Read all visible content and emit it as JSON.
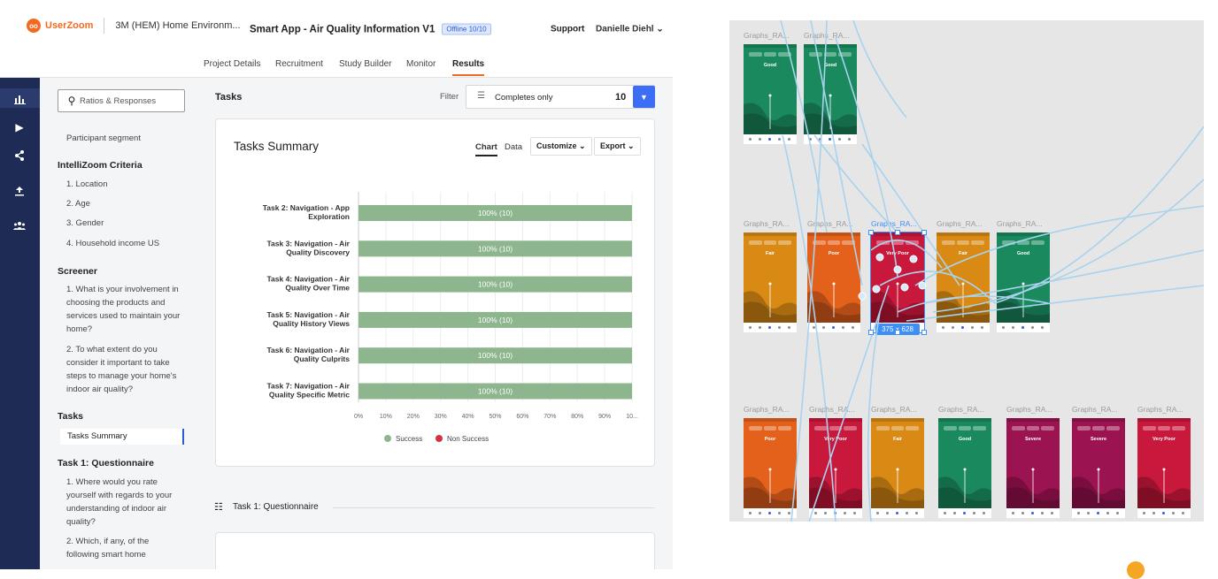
{
  "app": {
    "logo": "UserZoom",
    "org": "3M (HEM) Home Environm...",
    "study_title": "Smart App - Air Quality Information V1",
    "offline_badge": "Offline 10/10",
    "support": "Support",
    "user": "Danielle Diehl ⌄"
  },
  "nav_tabs": [
    "Project Details",
    "Recruitment",
    "Study Builder",
    "Monitor",
    "Results"
  ],
  "active_nav_tab": "Results",
  "rail_icons": [
    "bar-chart-icon",
    "play-icon",
    "share-icon",
    "upload-icon",
    "users-icon"
  ],
  "left_panel": {
    "search_placeholder": "Ratios & Responses",
    "participant_segment": "Participant segment",
    "intellizoom_heading": "IntelliZoom Criteria",
    "intellizoom_items": [
      "1. Location",
      "2. Age",
      "3. Gender",
      "4. Household income US"
    ],
    "screener_heading": "Screener",
    "screener_q1": "1. What is your involvement in choosing the products and services used to maintain your home?",
    "screener_q2": "2. To what extent do you consider it important to take steps to manage your home's indoor air quality?",
    "tasks_heading": "Tasks",
    "tasks_summary": "Tasks Summary",
    "task1_heading": "Task 1: Questionnaire",
    "task1_q1": "1. Where would you rate yourself with regards to your understanding of indoor air quality?",
    "task1_q2": "2. Which, if any, of the following smart home"
  },
  "main": {
    "tasks_title": "Tasks",
    "filter_label": "Filter",
    "filter_value": "Completes only",
    "filter_count": "10",
    "card_title": "Tasks Summary",
    "tab_chart": "Chart",
    "tab_data": "Data",
    "customize": "Customize ⌄",
    "export": "Export ⌄",
    "task1_section": "Task 1: Questionnaire"
  },
  "chart_data": {
    "type": "bar",
    "orientation": "horizontal",
    "categories": [
      "Task 2: Navigation - App Exploration",
      "Task 3: Navigation - Air Quality Discovery",
      "Task 4: Navigation - Air Quality Over Time",
      "Task 5: Navigation - Air Quality History Views",
      "Task 6: Navigation - Air Quality Culprits",
      "Task 7: Navigation - Air Quality Specific Metric"
    ],
    "category_lines": [
      [
        "Task 2: Navigation - App",
        "Exploration"
      ],
      [
        "Task 3: Navigation - Air",
        "Quality Discovery"
      ],
      [
        "Task 4: Navigation - Air",
        "Quality Over Time"
      ],
      [
        "Task 5: Navigation - Air",
        "Quality History Views"
      ],
      [
        "Task 6: Navigation - Air",
        "Quality Culprits"
      ],
      [
        "Task 7: Navigation - Air",
        "Quality Specific Metric"
      ]
    ],
    "series": [
      {
        "name": "Success",
        "values": [
          100,
          100,
          100,
          100,
          100,
          100
        ],
        "counts": [
          10,
          10,
          10,
          10,
          10,
          10
        ],
        "color": "#8db58e"
      },
      {
        "name": "Non Success",
        "values": [
          0,
          0,
          0,
          0,
          0,
          0
        ],
        "color": "#d0334a"
      }
    ],
    "data_labels": [
      "100% (10)",
      "100% (10)",
      "100% (10)",
      "100% (10)",
      "100% (10)",
      "100% (10)"
    ],
    "x_ticks": [
      "0%",
      "10%",
      "20%",
      "30%",
      "40%",
      "50%",
      "60%",
      "70%",
      "80%",
      "90%",
      "10..."
    ],
    "xlim": [
      0,
      100
    ],
    "grid": true,
    "legend_position": "bottom"
  },
  "canvas": {
    "rows": [
      [
        {
          "label": "Graphs_RA...",
          "status": "Good",
          "color": "#1a8a5e"
        },
        {
          "label": "Graphs_RA...",
          "status": "Good",
          "color": "#1a8a5e"
        }
      ],
      [
        {
          "label": "Graphs_RA...",
          "status": "Fair",
          "color": "#d98a14"
        },
        {
          "label": "Graphs_RA...",
          "status": "Poor",
          "color": "#e4611c"
        },
        {
          "label": "Graphs_RA...",
          "status": "Very Poor",
          "color": "#c8183c",
          "selected": true
        },
        {
          "label": "Graphs_RA...",
          "status": "Fair",
          "color": "#d98a14"
        },
        {
          "label": "Graphs_RA...",
          "status": "Good",
          "color": "#1a8a5e"
        }
      ],
      [
        {
          "label": "Graphs_RA...",
          "status": "Poor",
          "color": "#e4611c"
        },
        {
          "label": "Graphs_RA...",
          "status": "Very Poor",
          "color": "#c8183c"
        },
        {
          "label": "Graphs_RA...",
          "status": "Fair",
          "color": "#d98a14"
        },
        {
          "label": "Graphs_RA...",
          "status": "Good",
          "color": "#1a8a5e"
        },
        {
          "label": "Graphs_RA...",
          "status": "Severe",
          "color": "#9b1350"
        },
        {
          "label": "Graphs_RA...",
          "status": "Severe",
          "color": "#9b1350"
        },
        {
          "label": "Graphs_RA...",
          "status": "Very Poor",
          "color": "#c8183c"
        }
      ]
    ],
    "selection_size": "375 × 628",
    "connector_color": "#a8d2ee"
  }
}
